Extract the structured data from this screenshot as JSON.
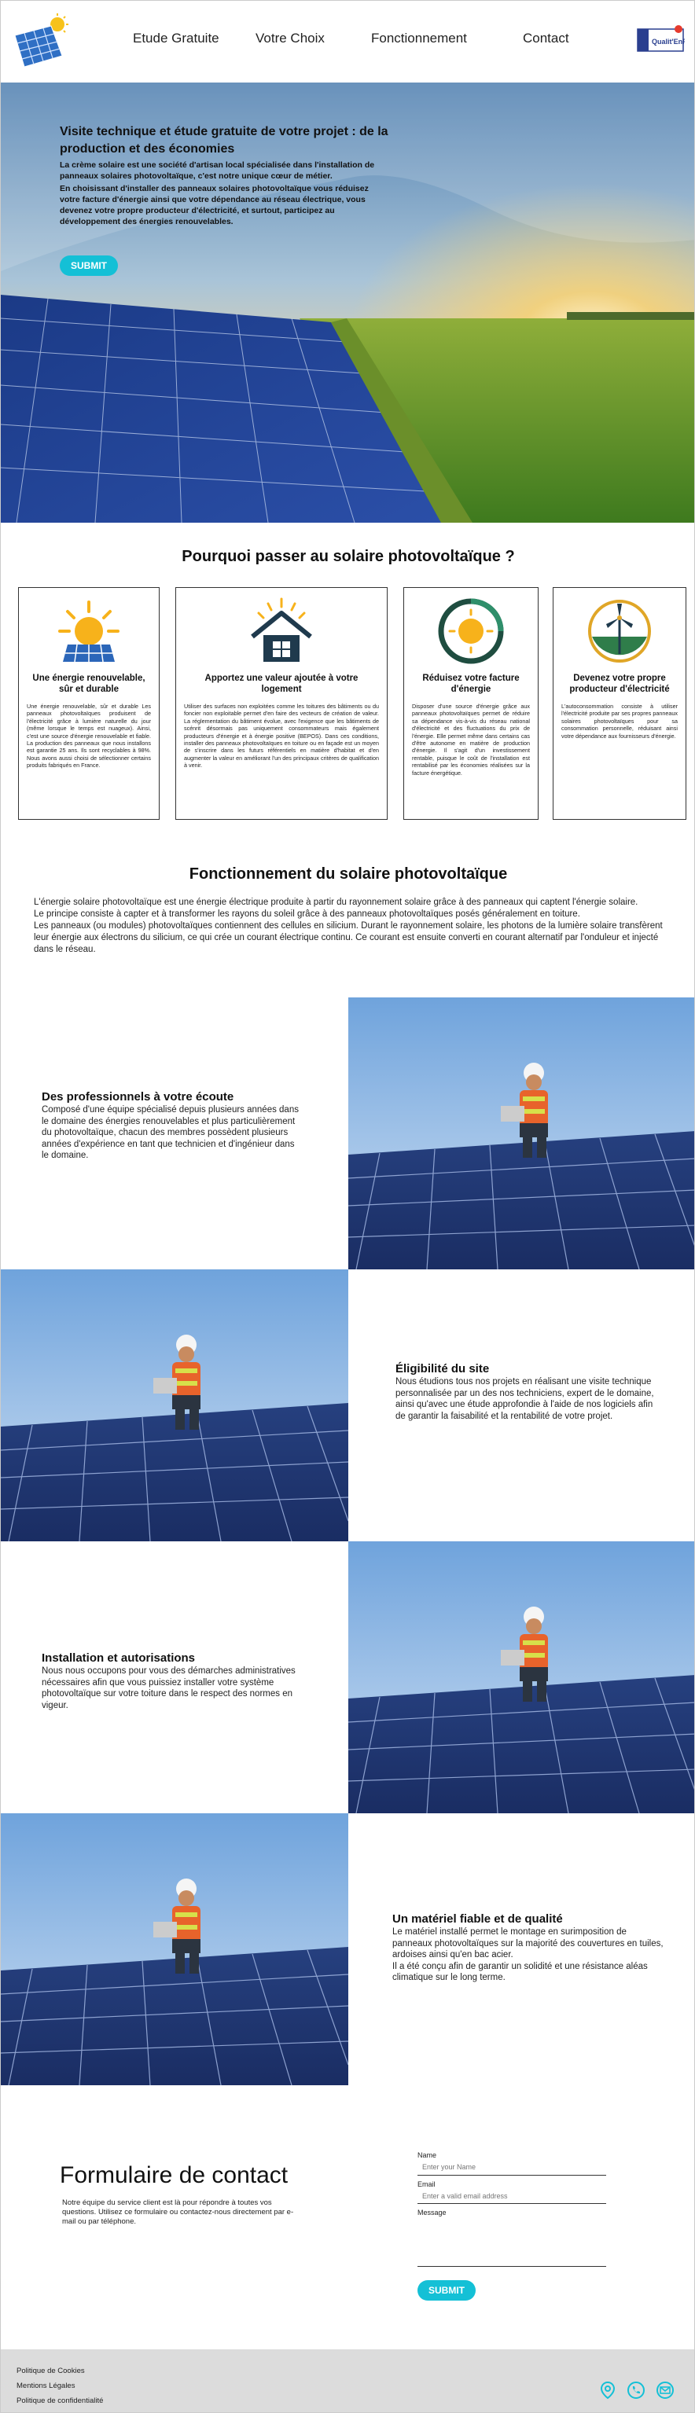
{
  "header": {
    "nav": [
      "Etude Gratuite",
      "Votre Choix",
      "Fonctionnement",
      "Contact"
    ],
    "logo_left": "solar-panel-sun-logo",
    "logo_right_text": "Qualit'EnR"
  },
  "hero": {
    "title": "Visite technique et étude gratuite de votre projet : de la production et des économies",
    "body_1": "La crème solaire est une société d'artisan local spécialisée dans l'installation de panneaux solaires photovoltaïque, c'est notre unique cœur de métier.",
    "body_2": "En choisissant d'installer des panneaux solaires photovoltaïque vous réduisez votre facture d'énergie ainsi que votre dépendance au réseau électrique, vous devenez votre propre producteur d'électricité, et surtout, participez au développement des énergies renouvelables.",
    "button": "SUBMIT"
  },
  "why": {
    "title": "Pourquoi passer au solaire photovoltaïque ?",
    "cards": [
      {
        "title": "Une énergie renouvelable, sûr et durable",
        "body": "Une énergie renouvelable, sûr et durable Les panneaux photovoltaïques produisent de l'électricité grâce à lumière naturelle du jour (même lorsque le temps est nuageux). Ainsi, c'est une source d'énergie renouvelable et fiable. La production des panneaux que nous installons est garantie 25 ans. Ils sont recyclables à 98%. Nous avons aussi choisi de sélectionner certains produits fabriqués en France.",
        "icon": "sun-energy-icon"
      },
      {
        "title": "Apportez une valeur ajoutée à votre logement",
        "body": "Utiliser des surfaces non exploitées comme les toitures des bâtiments ou du foncier non exploitable permet d'en faire des vecteurs de création de valeur. La réglementation du bâtiment évolue, avec l'exigence que les bâtiments de scénrit désormais pas uniquement consommateurs mais également producteurs d'énergie et à énergie positive (BEPOS). Dans ces conditions, installer des panneaux photovoltaïques en toiture ou en façade est un moyen de s'inscrire dans les futurs référentiels en matière d'habitat et d'en augmenter la valeur en améliorant l'un des principaux critères de qualification à venir.",
        "icon": "house-sun-icon"
      },
      {
        "title": "Réduisez votre facture d'énergie",
        "body": "Disposer d'une source d'énergie grâce aux panneaux photovoltaïques permet de réduire sa dépendance vis-à-vis du réseau national d'électricité et des fluctuations du prix de l'énergie. Elle permet même dans certains cas d'être autonome en matière de production d'énergie. Il s'agit d'un investissement rentable, puisque le coût de l'installation est rentabilisé par les économies réalisées sur la facture énergétique.",
        "icon": "sun-circle-icon"
      },
      {
        "title": "Devenez votre propre producteur d'électricité",
        "body": "L'autoconsommation consiste à utiliser l'électricité produite par ses propres panneaux solaires photovoltaïques pour sa consommation personnelle, réduisant ainsi votre dépendance aux fournisseurs d'énergie.",
        "icon": "wind-solar-icon"
      }
    ]
  },
  "fonctionnement": {
    "title": "Fonctionnement du solaire photovoltaïque",
    "body_1": "L'énergie solaire photovoltaïque est une énergie électrique produite à partir du rayonnement solaire grâce à des panneaux qui captent l'énergie solaire.",
    "body_2": "Le principe consiste à capter et à transformer les rayons du soleil grâce à des panneaux photovoltaïques posés généralement en toiture.",
    "body_3": "Les panneaux (ou modules) photovoltaïques contiennent des cellules en silicium. Durant le rayonnement solaire, les photons de la lumière solaire transfèrent leur énergie aux électrons du silicium, ce qui crée un courant électrique continu.  Ce courant est ensuite converti en courant alternatif par l'onduleur et injecté dans le réseau."
  },
  "features": [
    {
      "title": "Des professionnels à votre écoute",
      "body": "Composé d'une équipe spécialisé depuis plusieurs années dans le domaine des énergies renouvelables et plus particulièrement du photovoltaïque, chacun des membres possèdent plusieurs années d'expérience en tant que technicien et d'ingénieur dans le domaine."
    },
    {
      "title": "Éligibilité du site",
      "body": "Nous étudions tous nos projets en réalisant une visite technique personnalisée par un des nos techniciens, expert de le domaine, ainsi qu'avec une étude approfondie à l'aide de nos logiciels afin de garantir la faisabilité et la rentabilité de votre projet."
    },
    {
      "title": "Installation et autorisations",
      "body": "Nous nous occupons pour vous des démarches administratives nécessaires afin que vous puissiez installer votre système photovoltaïque sur votre toiture dans le respect des normes en vigeur."
    },
    {
      "title": "Un matériel fiable et de qualité",
      "body": "Le matériel installé permet le montage en surimposition de panneaux photovoltaïques sur la majorité des couvertures en tuiles, ardoises ainsi qu'en bac acier.",
      "body_2": "Il a été conçu afin de garantir un solidité et une résistance aléas climatique sur le long terme."
    }
  ],
  "contact": {
    "title": "Formulaire de contact",
    "description": "Notre équipe du service client est là pour répondre à toutes vos questions. Utilisez ce formulaire ou contactez-nous directement par e-mail ou par téléphone.",
    "name_label": "Name",
    "name_placeholder": "Enter your Name",
    "email_label": "Email",
    "email_placeholder": "Enter a valid email address",
    "message_label": "Message",
    "button": "SUBMIT"
  },
  "footer": {
    "links": [
      "Politique de Cookies",
      "Mentions Légales",
      "Politique de confidentialité"
    ],
    "icons": [
      "location-icon",
      "phone-icon",
      "email-icon"
    ],
    "accent": "#14c0d6"
  }
}
